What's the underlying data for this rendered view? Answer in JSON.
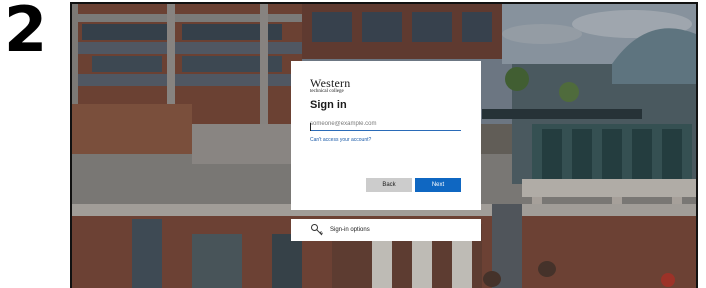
{
  "step": {
    "number": "2"
  },
  "signin": {
    "logo": {
      "main": "Western",
      "sub": "technical college"
    },
    "title": "Sign in",
    "email": {
      "placeholder": "someone@example.com",
      "value": ""
    },
    "cant_access_link": "Can't access your account?",
    "back_button": "Back",
    "next_button": "Next"
  },
  "options": {
    "label": "Sign-in options",
    "icon": "key-icon"
  },
  "colors": {
    "accent": "#0f67c2",
    "link": "#1a5aa8",
    "back_button_bg": "#cccccc"
  }
}
